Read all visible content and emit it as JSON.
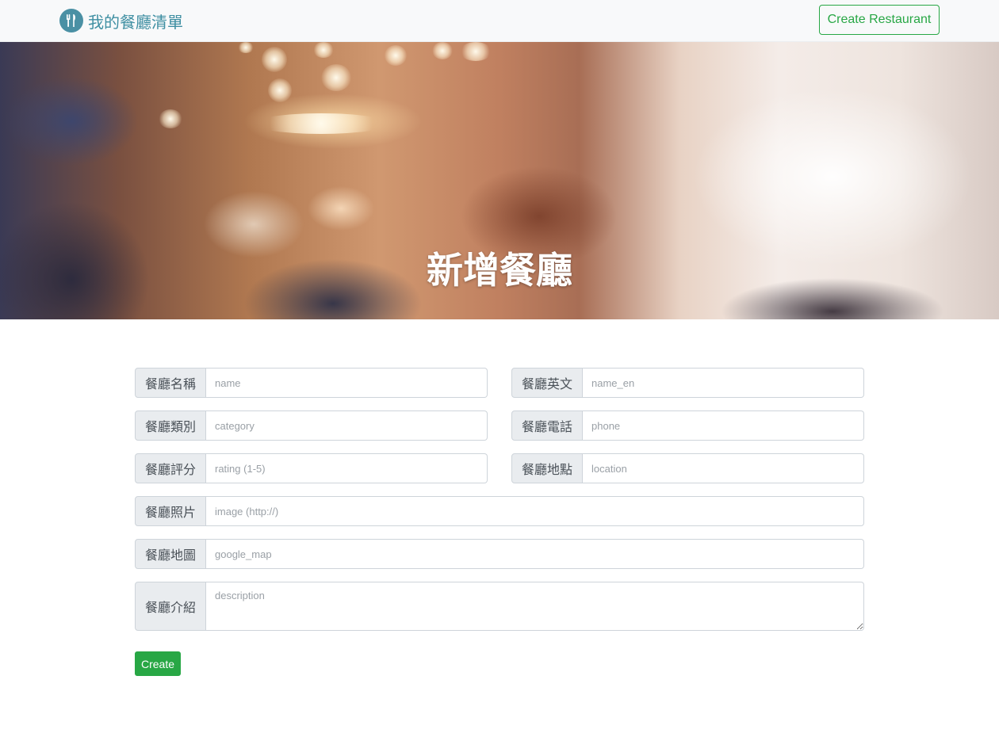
{
  "navbar": {
    "brand_text": "我的餐廳清單",
    "brand_icon": "fork-knife-icon",
    "create_button_label": "Create Restaurant"
  },
  "hero": {
    "title": "新增餐廳"
  },
  "form": {
    "fields": [
      {
        "label": "餐廳名稱",
        "placeholder": "name"
      },
      {
        "label": "餐廳英文",
        "placeholder": "name_en"
      },
      {
        "label": "餐廳類別",
        "placeholder": "category"
      },
      {
        "label": "餐廳電話",
        "placeholder": "phone"
      },
      {
        "label": "餐廳評分",
        "placeholder": "rating (1-5)"
      },
      {
        "label": "餐廳地點",
        "placeholder": "location"
      },
      {
        "label": "餐廳照片",
        "placeholder": "image (http://)"
      },
      {
        "label": "餐廳地圖",
        "placeholder": "google_map"
      },
      {
        "label": "餐廳介紹",
        "placeholder": "description"
      }
    ],
    "submit_label": "Create"
  },
  "colors": {
    "accent_green": "#28a745",
    "brand_teal": "#3f8fa2",
    "navbar_bg": "#f8f9fa",
    "addon_bg": "#e9ecef"
  }
}
